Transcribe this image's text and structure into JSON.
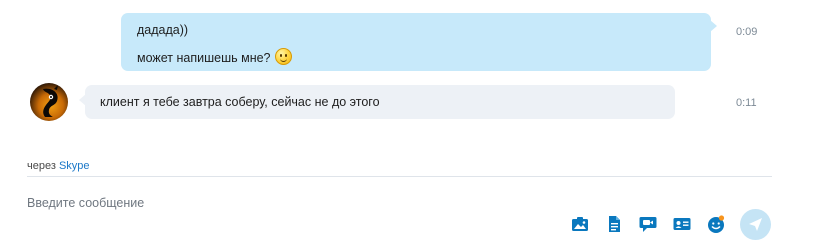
{
  "messages": [
    {
      "direction": "outgoing",
      "lines": [
        "дадада))",
        "может напишешь мне?"
      ],
      "emoji": "smile-emoji",
      "time": "0:09"
    },
    {
      "direction": "incoming",
      "text": "клиент я тебе завтра соберу, сейчас не до этого",
      "time": "0:11"
    }
  ],
  "via": {
    "prefix": "через",
    "link": "Skype"
  },
  "compose": {
    "placeholder": "Введите сообщение"
  },
  "toolbar": {
    "icons": [
      "send-photo-icon",
      "send-file-icon",
      "video-message-icon",
      "send-contact-icon",
      "emoticon-icon",
      "send-icon"
    ]
  },
  "colors": {
    "outgoing_bubble": "#c7e9fa",
    "incoming_bubble": "#edf1f6",
    "accent": "#1b78c8",
    "timestamp": "#7d8a96"
  }
}
